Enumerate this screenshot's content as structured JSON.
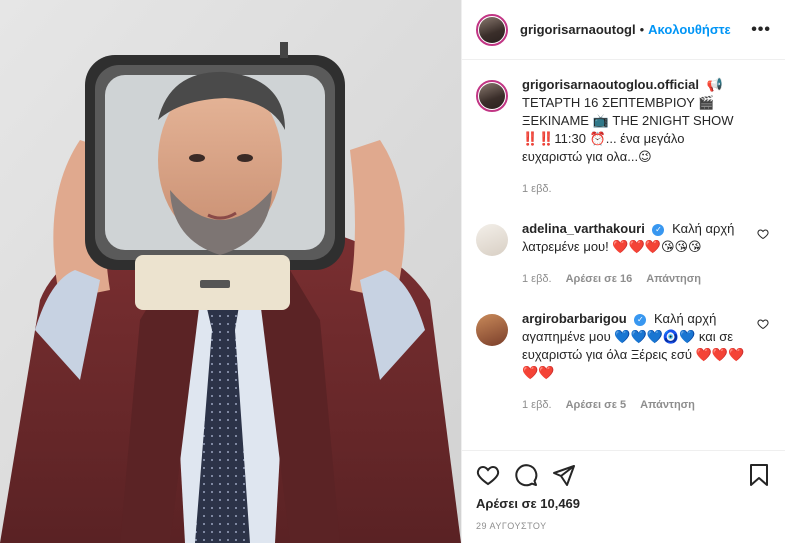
{
  "header": {
    "username": "grigorisarnaoutogl",
    "separator": "•",
    "follow_label": "Ακολουθήστε",
    "more_icon": "more-horizontal-icon"
  },
  "caption": {
    "username": "grigorisarnaoutoglou.official",
    "text": "📢 ΤΕΤΑΡΤΗ 16 ΣΕΠΤΕΜΒΡΙΟΥ 🎬 ΞΕΚΙΝΑΜΕ 📺 THE 2NIGHT SHOW ‼️‼️11:30 ⏰... ένα μεγάλο ευχαριστώ για ολα...😉",
    "time": "1 εβδ."
  },
  "comments": [
    {
      "username": "adelina_varthakouri",
      "text": "Καλή αρχή λατρεμένε μου! ❤️❤️❤️😘😘😘",
      "time": "1 εβδ.",
      "likes": "Αρέσει σε 16",
      "reply": "Απάντηση"
    },
    {
      "username": "argirobarbarigou",
      "text": "Καλή αρχή αγαπημένε μου 💙💙💙🧿💙 και σε ευχαριστώ για όλα Ξέρεις εσύ ❤️❤️❤️❤️❤️",
      "time": "1 εβδ.",
      "likes": "Αρέσει σε 5",
      "reply": "Απάντηση"
    }
  ],
  "footer": {
    "likes": "Αρέσει σε 10,469",
    "date": "29 ΑΥΓΟΥΣΤΟΥ"
  },
  "colors": {
    "accent": "#0095f6",
    "jacket": "#6e2a2c",
    "background": "#dcdcdc",
    "story_ring": "#c13584"
  }
}
